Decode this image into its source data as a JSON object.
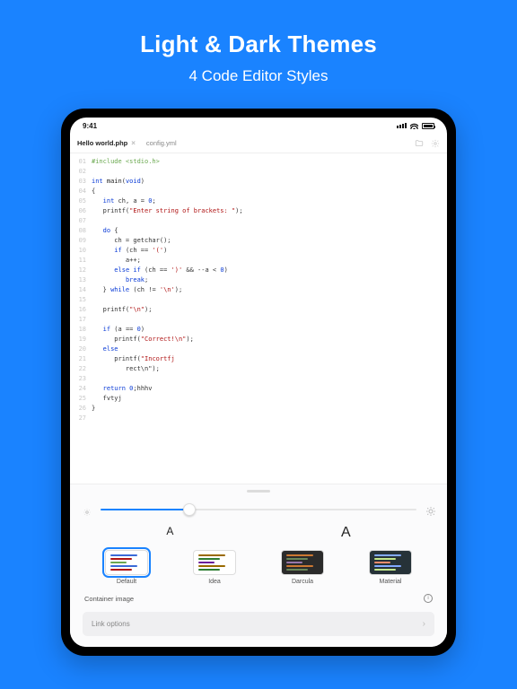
{
  "hero": {
    "title": "Light & Dark Themes",
    "subtitle": "4 Code Editor Styles"
  },
  "statusbar": {
    "time": "9:41"
  },
  "tabs": {
    "items": [
      {
        "label": "Hello world.php",
        "active": true
      },
      {
        "label": "config.yml",
        "active": false
      }
    ]
  },
  "code": {
    "lines": [
      {
        "n": "01",
        "segs": [
          [
            "pp",
            "#include <stdio.h>"
          ]
        ]
      },
      {
        "n": "02",
        "segs": [
          [
            "",
            ""
          ]
        ]
      },
      {
        "n": "03",
        "segs": [
          [
            "kw",
            "int "
          ],
          [
            "fn",
            "main"
          ],
          [
            "",
            "("
          ],
          [
            "kw",
            "void"
          ],
          [
            "",
            ")"
          ]
        ]
      },
      {
        "n": "04",
        "segs": [
          [
            "",
            "{"
          ]
        ]
      },
      {
        "n": "05",
        "segs": [
          [
            "",
            "   "
          ],
          [
            "kw",
            "int "
          ],
          [
            "",
            "ch, a = "
          ],
          [
            "num",
            "0"
          ],
          [
            "",
            ";"
          ]
        ]
      },
      {
        "n": "06",
        "segs": [
          [
            "",
            "   printf("
          ],
          [
            "str",
            "\"Enter string of brackets: \""
          ],
          [
            "",
            ");"
          ]
        ]
      },
      {
        "n": "07",
        "segs": [
          [
            "",
            ""
          ]
        ]
      },
      {
        "n": "08",
        "segs": [
          [
            "",
            "   "
          ],
          [
            "kw",
            "do"
          ],
          [
            "",
            ""
          ],
          " {"
        ]
      },
      {
        "n": "09",
        "segs": [
          [
            "",
            "      ch = getchar();"
          ]
        ]
      },
      {
        "n": "10",
        "segs": [
          [
            "",
            "      "
          ],
          [
            "kw",
            "if"
          ],
          [
            "",
            " (ch == "
          ],
          [
            "ch",
            "'('"
          ],
          [
            "",
            ")"
          ]
        ]
      },
      {
        "n": "11",
        "segs": [
          [
            "",
            "         a++;"
          ]
        ]
      },
      {
        "n": "12",
        "segs": [
          [
            "",
            "      "
          ],
          [
            "kw",
            "else if"
          ],
          [
            "",
            " (ch == "
          ],
          [
            "ch",
            "')'"
          ],
          [
            "",
            " && --a < "
          ],
          [
            "num",
            "0"
          ],
          [
            "",
            ")"
          ]
        ]
      },
      {
        "n": "13",
        "segs": [
          [
            "",
            "         "
          ],
          [
            "kw",
            "break"
          ],
          [
            "",
            ";"
          ]
        ]
      },
      {
        "n": "14",
        "segs": [
          [
            "",
            "   } "
          ],
          [
            "kw",
            "while"
          ],
          [
            "",
            " (ch != "
          ],
          [
            "ch",
            "'\\n'"
          ],
          [
            "",
            ");"
          ]
        ]
      },
      {
        "n": "15",
        "segs": [
          [
            "",
            ""
          ]
        ]
      },
      {
        "n": "16",
        "segs": [
          [
            "",
            "   printf("
          ],
          [
            "str",
            "\"\\n\""
          ],
          [
            "",
            ");"
          ]
        ]
      },
      {
        "n": "17",
        "segs": [
          [
            "",
            ""
          ]
        ]
      },
      {
        "n": "18",
        "segs": [
          [
            "",
            "   "
          ],
          [
            "kw",
            "if"
          ],
          [
            "",
            " (a == "
          ],
          [
            "num",
            "0"
          ],
          [
            "",
            ")"
          ]
        ]
      },
      {
        "n": "19",
        "segs": [
          [
            "",
            "      printf("
          ],
          [
            "str",
            "\"Correct!\\n\""
          ],
          [
            "",
            ");"
          ]
        ]
      },
      {
        "n": "20",
        "segs": [
          [
            "",
            "   "
          ],
          [
            "kw",
            "else"
          ]
        ]
      },
      {
        "n": "21",
        "segs": [
          [
            "",
            "      printf("
          ],
          [
            "str",
            "\"Incortfj"
          ]
        ]
      },
      {
        "n": "22",
        "segs": [
          [
            "",
            "         rect\\n\");"
          ]
        ]
      },
      {
        "n": "23",
        "segs": [
          [
            "",
            ""
          ]
        ]
      },
      {
        "n": "24",
        "segs": [
          [
            "",
            "   "
          ],
          [
            "kw",
            "return "
          ],
          [
            "num",
            "0"
          ],
          [
            "",
            ";hhhv"
          ]
        ]
      },
      {
        "n": "25",
        "segs": [
          [
            "",
            "   fvtyj"
          ]
        ]
      },
      {
        "n": "26",
        "segs": [
          [
            "",
            "}"
          ]
        ]
      },
      {
        "n": "27",
        "segs": [
          [
            "",
            ""
          ]
        ]
      }
    ]
  },
  "sheet": {
    "brightness_pct": 28,
    "font_small": "A",
    "font_large": "A",
    "themes": [
      {
        "name": "Default",
        "bg": "#ffffff",
        "c1": "#3b6bd8",
        "c2": "#b01515",
        "c3": "#6aa84f",
        "selected": true
      },
      {
        "name": "Idea",
        "bg": "#ffffff",
        "c1": "#9a6a00",
        "c2": "#2e7d32",
        "c3": "#6a1b9a",
        "selected": false
      },
      {
        "name": "Darcula",
        "bg": "#2b2b2b",
        "c1": "#cc7832",
        "c2": "#6a8759",
        "c3": "#9876aa",
        "selected": false
      },
      {
        "name": "Material",
        "bg": "#263238",
        "c1": "#82aaff",
        "c2": "#c3e88d",
        "c3": "#f78c6c",
        "selected": false
      }
    ],
    "container_label": "Container image",
    "link_options": "Link options"
  }
}
